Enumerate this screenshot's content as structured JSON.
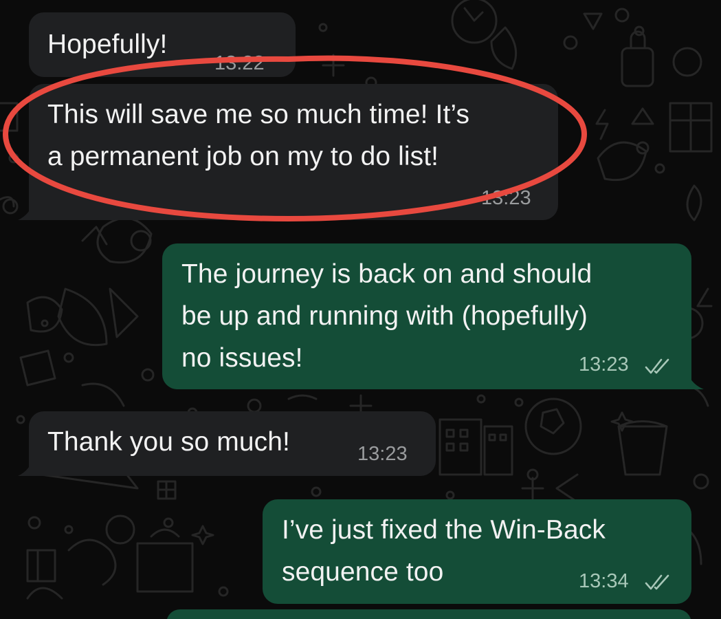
{
  "colors": {
    "background": "#0b0b0b",
    "incoming_bubble": "#1f2022",
    "outgoing_bubble": "#144d37",
    "text": "#f2f2f2",
    "timestamp": "#9a9c9e",
    "annotation": "#e8493f"
  },
  "messages": [
    {
      "direction": "incoming",
      "text": "Hopefully!",
      "time": "13:22"
    },
    {
      "direction": "incoming",
      "lines": [
        "This will save me so much time! It’s",
        "a permanent job on my to do list!"
      ],
      "time": "13:23",
      "annotated": true
    },
    {
      "direction": "outgoing",
      "lines": [
        "The journey is back on and should",
        "be up and running with (hopefully)",
        "no issues!"
      ],
      "time": "13:23",
      "status": "read"
    },
    {
      "direction": "incoming",
      "text": "Thank you so much!",
      "time": "13:23"
    },
    {
      "direction": "outgoing",
      "lines": [
        "I’ve just fixed the Win-Back",
        "sequence too"
      ],
      "time": "13:34",
      "status": "read"
    }
  ],
  "icons": [
    "double-check-icon",
    "annotation-circle"
  ]
}
